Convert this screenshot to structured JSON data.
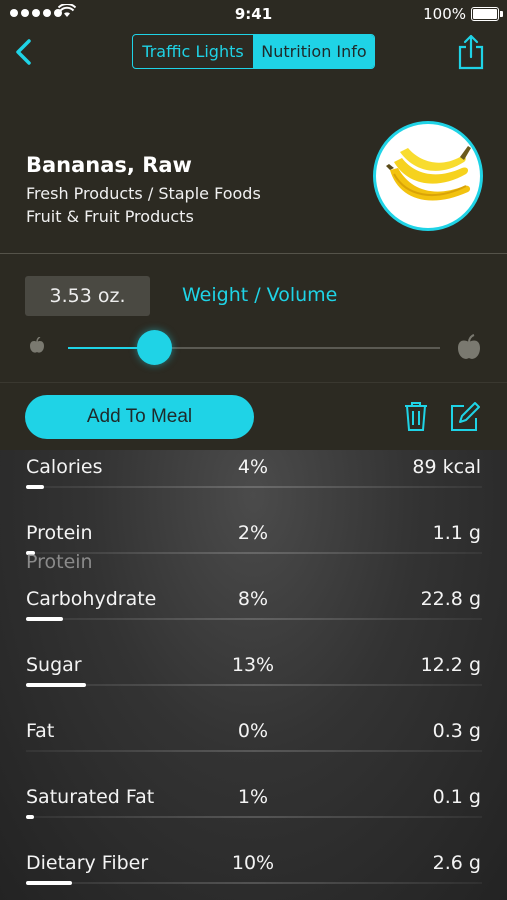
{
  "status_bar": {
    "time": "9:41",
    "battery": "100%"
  },
  "nav": {
    "segments": [
      "Traffic Lights",
      "Nutrition Info"
    ],
    "active_segment": "Nutrition Info"
  },
  "food": {
    "name": "Bananas, Raw",
    "category": "Fresh Products / Staple Foods",
    "subcategory": "Fruit & Fruit Products"
  },
  "weight": {
    "value": "3.53 oz.",
    "label": "Weight / Volume",
    "slider_fraction": 0.23
  },
  "actions": {
    "add_label": "Add To Meal"
  },
  "nutrients": [
    {
      "name": "Calories",
      "percent": "4%",
      "value": "89 kcal",
      "fraction": 0.04
    },
    {
      "name": "Protein",
      "percent": "2%",
      "value": "1.1 g",
      "fraction": 0.02
    },
    {
      "name": "Carbohydrate",
      "percent": "8%",
      "value": "22.8 g",
      "fraction": 0.08
    },
    {
      "name": "Sugar",
      "percent": "13%",
      "value": "12.2 g",
      "fraction": 0.13
    },
    {
      "name": "Fat",
      "percent": "0%",
      "value": "0.3 g",
      "fraction": 0.0
    },
    {
      "name": "Saturated Fat",
      "percent": "1%",
      "value": "0.1 g",
      "fraction": 0.01
    },
    {
      "name": "Dietary Fiber",
      "percent": "10%",
      "value": "2.6 g",
      "fraction": 0.1
    }
  ],
  "ghost_label": "Protein",
  "colors": {
    "accent": "#1fd3e6",
    "header_bg": "#2c2a22"
  },
  "icons": [
    "back-chevron-icon",
    "share-icon",
    "small-apple-icon",
    "large-apple-icon",
    "trash-icon",
    "edit-icon",
    "wifi-icon",
    "battery-icon"
  ]
}
